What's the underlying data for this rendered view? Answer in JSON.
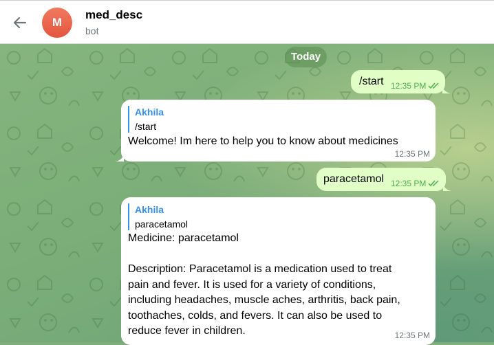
{
  "header": {
    "avatar_letter": "M",
    "title": "med_desc",
    "status": "bot",
    "back_icon": "arrow-left-icon"
  },
  "chat": {
    "date_label": "Today",
    "messages": [
      {
        "direction": "outgoing",
        "text": "/start",
        "time": "12:35 PM",
        "read_icon": "double-check-icon"
      },
      {
        "direction": "incoming",
        "reply_name": "Akhila",
        "reply_text": "/start",
        "text": "Welcome! Im here to help you to know about medicines",
        "time": "12:35 PM"
      },
      {
        "direction": "outgoing",
        "text": "paracetamol",
        "time": "12:35 PM",
        "read_icon": "double-check-icon"
      },
      {
        "direction": "incoming",
        "reply_name": "Akhila",
        "reply_text": "paracetamol",
        "text_lines": [
          "Medicine: paracetamol",
          "",
          "Description: Paracetamol is a medication used to treat",
          "pain and fever. It is used for a variety of conditions,",
          "including headaches, muscle aches, arthritis, back pain,",
          "toothaches, colds, and fevers. It can also be used to",
          "reduce fever in children."
        ],
        "time": "12:35 PM"
      }
    ]
  },
  "colors": {
    "accent": "#3390ec",
    "outgoing_bubble": "#e1fec6",
    "incoming_bubble": "#ffffff",
    "check_color": "#4fae4e",
    "avatar": "#e5553f"
  }
}
